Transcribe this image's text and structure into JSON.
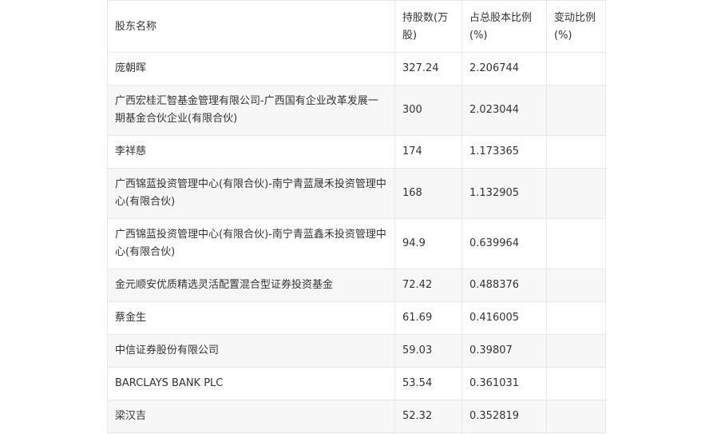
{
  "table": {
    "headers": [
      "股东名称",
      "持股数(万股)",
      "占总股本比例(%)",
      "变动比例(%)"
    ],
    "rows": [
      {
        "name": "庞朝晖",
        "shares": "327.24",
        "ratio": "2.206744",
        "change": ""
      },
      {
        "name": "广西宏桂汇智基金管理有限公司-广西国有企业改革发展一期基金合伙企业(有限合伙)",
        "shares": "300",
        "ratio": "2.023044",
        "change": ""
      },
      {
        "name": "李祥慈",
        "shares": "174",
        "ratio": "1.173365",
        "change": ""
      },
      {
        "name": "广西锦蓝投资管理中心(有限合伙)-南宁青蓝晟禾投资管理中心(有限合伙)",
        "shares": "168",
        "ratio": "1.132905",
        "change": ""
      },
      {
        "name": "广西锦蓝投资管理中心(有限合伙)-南宁青蓝鑫禾投资管理中心(有限合伙)",
        "shares": "94.9",
        "ratio": "0.639964",
        "change": ""
      },
      {
        "name": "金元顺安优质精选灵活配置混合型证券投资基金",
        "shares": "72.42",
        "ratio": "0.488376",
        "change": ""
      },
      {
        "name": "蔡金生",
        "shares": "61.69",
        "ratio": "0.416005",
        "change": ""
      },
      {
        "name": "中信证券股份有限公司",
        "shares": "59.03",
        "ratio": "0.39807",
        "change": ""
      },
      {
        "name": "BARCLAYS BANK PLC",
        "shares": "53.54",
        "ratio": "0.361031",
        "change": ""
      },
      {
        "name": "梁汉吉",
        "shares": "52.32",
        "ratio": "0.352819",
        "change": ""
      }
    ]
  }
}
